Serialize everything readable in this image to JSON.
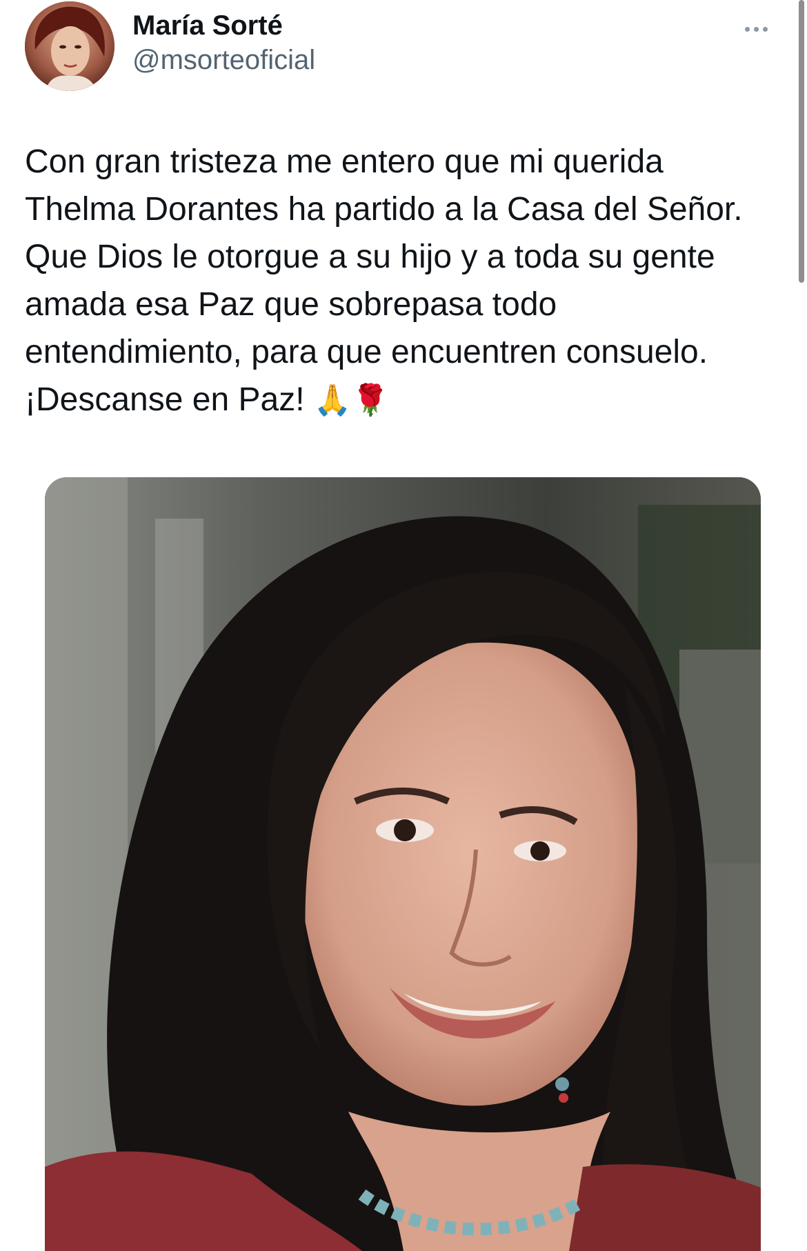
{
  "tweet": {
    "author": {
      "display_name": "María Sorté",
      "handle": "@msorteoficial",
      "avatar_icon": "profile-photo"
    },
    "more_icon": "more-horizontal-icon",
    "text_line_1": "Con gran tristeza me entero que mi querida",
    "text_line_2": "Thelma Dorantes ha partido a la Casa del Señor.",
    "text_line_3": "Que Dios le otorgue a su hijo y a toda su gente",
    "text_line_4": "amada esa Paz que sobrepasa todo",
    "text_line_5": "entendimiento, para que encuentren consuelo.",
    "text_line_6": "¡Descanse en Paz!",
    "emoji_1": "🙏",
    "emoji_2": "🌹",
    "media": {
      "type": "photo"
    }
  },
  "colors": {
    "text_primary": "#0f1419",
    "text_secondary": "#536471",
    "background": "#ffffff"
  }
}
